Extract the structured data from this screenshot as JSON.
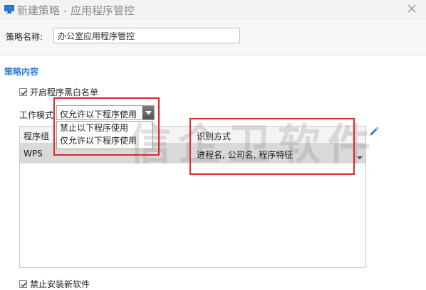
{
  "window": {
    "title": "新建策略 - 应用程序管控",
    "app_icon": "monitor-icon",
    "close_icon": "close-icon"
  },
  "form": {
    "name_label": "策略名称:",
    "name_value": "办公室应用程序管控"
  },
  "section": {
    "title": "策略内容"
  },
  "options": {
    "blacklist_label": "开启程序黑白名单",
    "blacklist_checked": true,
    "no_install_label": "禁止安装新软件",
    "no_install_checked": true
  },
  "mode": {
    "label": "工作模式",
    "selected": "仅允许以下程序使用",
    "options": [
      "禁止以下程序使用",
      "仅允许以下程序使用"
    ]
  },
  "table": {
    "headers": [
      "程序组",
      "识别方式"
    ],
    "rows": [
      {
        "group": "WPS",
        "method": "进程名, 公司名, 程序特征"
      }
    ]
  },
  "watermark": "信企卫软件",
  "colors": {
    "accent": "#2b7bd6",
    "highlight": "#e0262a",
    "selected_row": "#d9d9d9"
  }
}
